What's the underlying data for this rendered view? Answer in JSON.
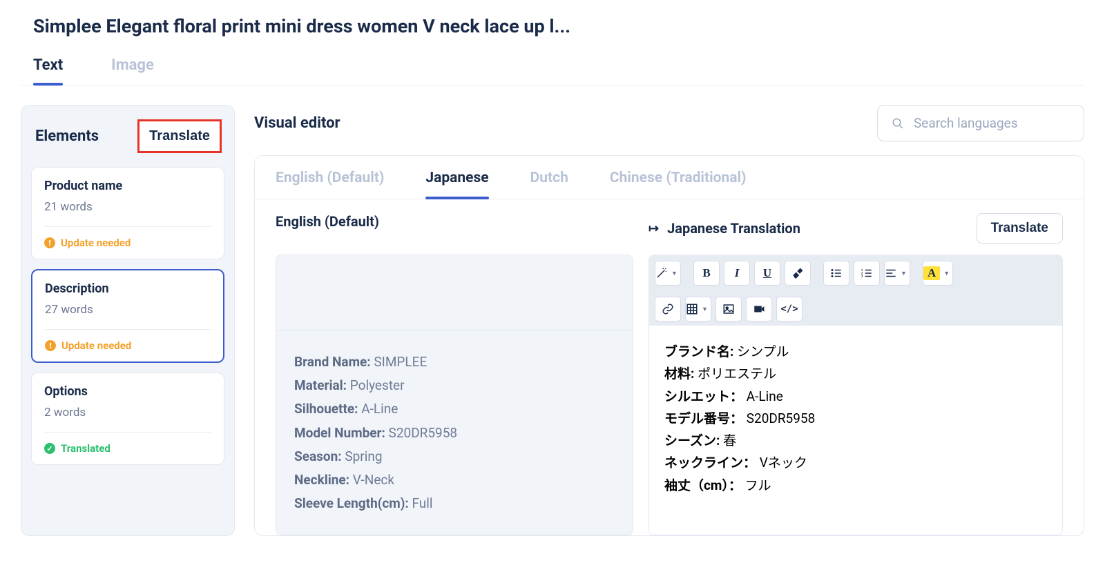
{
  "header": {
    "title": "Simplee Elegant floral print mini dress women V neck lace up l..."
  },
  "main_tabs": [
    {
      "label": "Text",
      "active": true
    },
    {
      "label": "Image",
      "active": false
    }
  ],
  "sidebar": {
    "title": "Elements",
    "translate_label": "Translate",
    "items": [
      {
        "name": "Product name",
        "words": "21 words",
        "status": "Update needed",
        "status_type": "update",
        "selected": false
      },
      {
        "name": "Description",
        "words": "27 words",
        "status": "Update needed",
        "status_type": "update",
        "selected": true
      },
      {
        "name": "Options",
        "words": "2 words",
        "status": "Translated",
        "status_type": "translated",
        "selected": false
      }
    ]
  },
  "editor": {
    "title": "Visual editor",
    "search_placeholder": "Search languages",
    "lang_tabs": [
      {
        "label": "English (Default)",
        "active": false
      },
      {
        "label": "Japanese",
        "active": true
      },
      {
        "label": "Dutch",
        "active": false
      },
      {
        "label": "Chinese (Traditional)",
        "active": false
      }
    ],
    "source_heading": "English (Default)",
    "target_heading": "Japanese Translation",
    "translate_button": "Translate",
    "source_pairs": [
      {
        "k": "Brand Name:",
        "v": " SIMPLEE"
      },
      {
        "k": "Material:",
        "v": " Polyester"
      },
      {
        "k": "Silhouette:",
        "v": " A-Line"
      },
      {
        "k": "Model Number:",
        "v": " S20DR5958"
      },
      {
        "k": "Season:",
        "v": " Spring"
      },
      {
        "k": "Neckline:",
        "v": " V-Neck"
      },
      {
        "k": "Sleeve Length(cm):",
        "v": " Full"
      }
    ],
    "target_pairs": [
      {
        "k": "ブランド名:",
        "v": "  シンプル"
      },
      {
        "k": "材料:",
        "v": " ポリエステル"
      },
      {
        "k": "シルエット：",
        "v": "  A-Line"
      },
      {
        "k": "モデル番号：",
        "v": "  S20DR5958"
      },
      {
        "k": "シーズン:",
        "v": "  春"
      },
      {
        "k": "ネックライン：",
        "v": "  Vネック"
      },
      {
        "k": "袖丈（cm）：",
        "v": " フル"
      }
    ]
  }
}
